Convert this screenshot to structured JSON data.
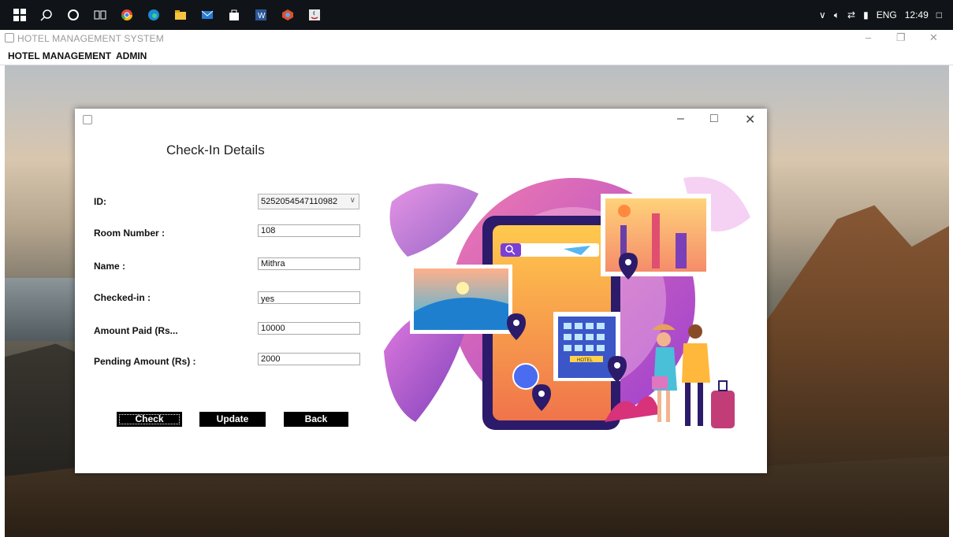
{
  "taskbar": {
    "icons": [
      "windows-start-icon",
      "search-icon",
      "cortana-icon",
      "task-view-icon",
      "chrome-icon",
      "edge-icon",
      "file-explorer-icon",
      "mail-icon",
      "store-icon",
      "word-icon",
      "app-icon",
      "java-icon"
    ],
    "tray": {
      "language": "ENG",
      "time": "12:49"
    }
  },
  "window": {
    "title": "HOTEL MANAGEMENT SYSTEM"
  },
  "menu": {
    "items": [
      "HOTEL MANAGEMENT",
      "ADMIN"
    ]
  },
  "dialog": {
    "heading": "Check-In Details",
    "labels": {
      "id": "ID:",
      "room_number": "Room Number :",
      "name": "Name :",
      "checked_in": "Checked-in :",
      "amount_paid": "Amount Paid (Rs...",
      "pending_amount": "Pending Amount (Rs) :"
    },
    "values": {
      "id": "5252054547110982",
      "room_number": "108",
      "name": "Mithra",
      "checked_in": "yes",
      "amount_paid": "10000",
      "pending_amount": "2000"
    },
    "buttons": {
      "check": "Check",
      "update": "Update",
      "back": "Back"
    },
    "illustration": {
      "hotel_sign": "HOTEL"
    }
  },
  "colors": {
    "button_bg": "#000000",
    "taskbar_bg": "#101418",
    "dialog_bg": "#ffffff"
  }
}
